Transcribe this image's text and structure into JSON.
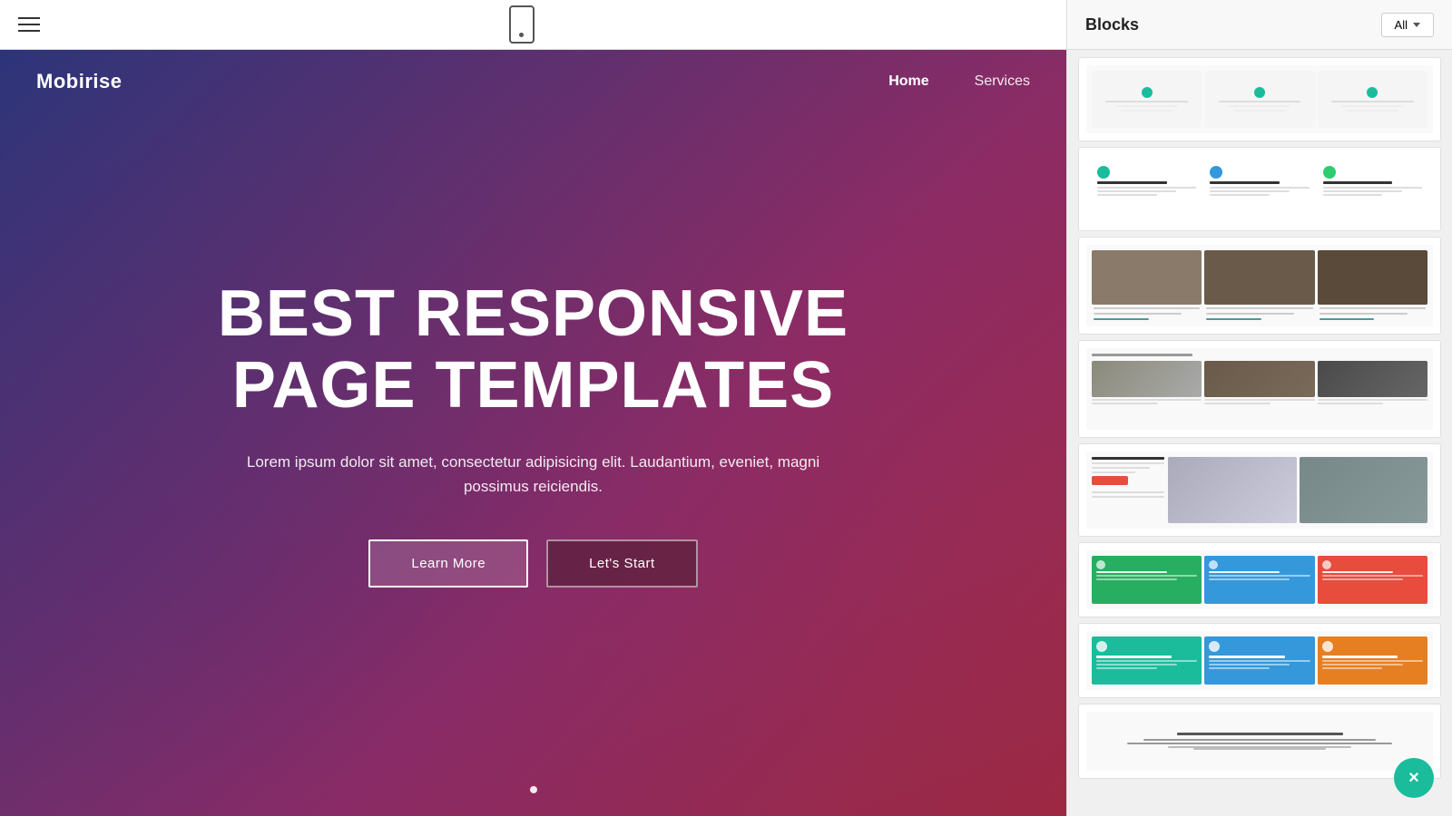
{
  "toolbar": {
    "hamburger_label": "menu",
    "device_label": "mobile preview"
  },
  "hero": {
    "brand": "Mobirise",
    "nav_links": [
      {
        "label": "Home",
        "active": true
      },
      {
        "label": "Services",
        "active": false
      }
    ],
    "title_line1": "BEST RESPONSIVE",
    "title_line2": "PAGE TEMPLATES",
    "subtitle": "Lorem ipsum dolor sit amet, consectetur adipisicing elit. Laudantium, eveniet, magni possimus reiciendis.",
    "btn_learn_more": "Learn More",
    "btn_lets_start": "Let's Start"
  },
  "blocks_panel": {
    "title": "Blocks",
    "filter_btn": "All",
    "close_btn": "×"
  }
}
